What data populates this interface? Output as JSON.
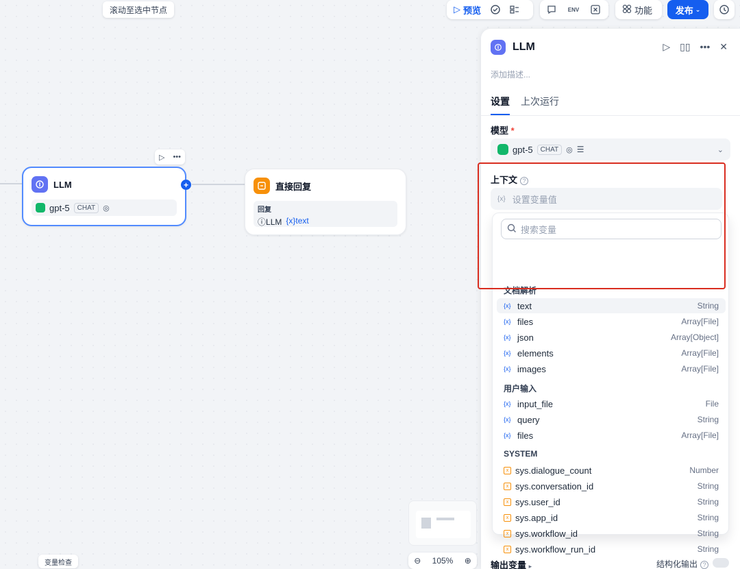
{
  "canvas": {
    "scroll_to_node": "滚动至选中节点",
    "variable_inspect": "变量检查",
    "zoom": "105%"
  },
  "toolbar": {
    "preview": "预览",
    "features": "功能",
    "publish": "发布"
  },
  "nodes": {
    "llm": {
      "title": "LLM",
      "model": "gpt-5",
      "mode_badge": "CHAT"
    },
    "reply": {
      "title": "直接回复",
      "field_label": "回复",
      "source": "LLM",
      "variable": "text"
    }
  },
  "panel": {
    "title": "LLM",
    "description_placeholder": "添加描述...",
    "tabs": [
      {
        "label": "设置",
        "active": true
      },
      {
        "label": "上次运行",
        "active": false
      }
    ],
    "model_label": "模型",
    "model_value": "gpt-5",
    "model_badge": "CHAT",
    "context_label": "上下文",
    "context_placeholder": "设置变量值",
    "search_placeholder": "搜索变量",
    "output_label": "输出变量",
    "structured_output_label": "结构化输出"
  },
  "variable_groups": [
    {
      "title": "文档解析",
      "items": [
        {
          "name": "text",
          "type": "String",
          "highlighted": true
        },
        {
          "name": "files",
          "type": "Array[File]"
        },
        {
          "name": "json",
          "type": "Array[Object]"
        },
        {
          "name": "elements",
          "type": "Array[File]"
        },
        {
          "name": "images",
          "type": "Array[File]"
        }
      ]
    },
    {
      "title": "用户输入",
      "items": [
        {
          "name": "input_file",
          "type": "File"
        },
        {
          "name": "query",
          "type": "String"
        },
        {
          "name": "files",
          "type": "Array[File]"
        }
      ]
    },
    {
      "title": "SYSTEM",
      "items": [
        {
          "name": "sys.dialogue_count",
          "type": "Number"
        },
        {
          "name": "sys.conversation_id",
          "type": "String"
        },
        {
          "name": "sys.user_id",
          "type": "String"
        },
        {
          "name": "sys.app_id",
          "type": "String"
        },
        {
          "name": "sys.workflow_id",
          "type": "String"
        },
        {
          "name": "sys.workflow_run_id",
          "type": "String"
        }
      ]
    }
  ],
  "colors": {
    "accent": "#155eef",
    "highlight_border": "#d92d20",
    "llm_icon": "#6172f3",
    "reply_icon": "#f79009",
    "model_icon": "#12b76a"
  }
}
